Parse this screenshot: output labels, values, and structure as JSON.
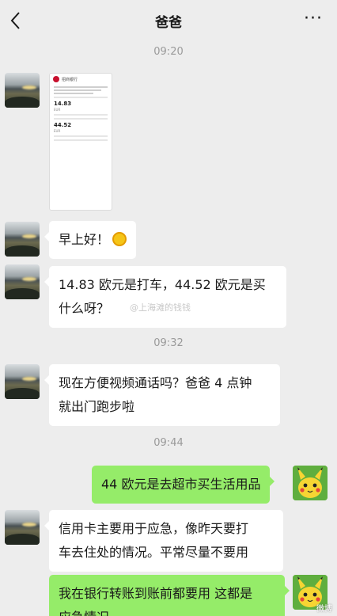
{
  "header": {
    "title": "爸爸",
    "more": "···"
  },
  "times": [
    "09:20",
    "09:32",
    "09:44"
  ],
  "messages": {
    "image_amount_1": "14.83",
    "image_amount_2": "44.52",
    "greeting": "早上好！",
    "question_1": "14.83 欧元是打车，44.52 欧元是买",
    "question_2": "什么呀？",
    "video_1": "现在方便视频通话吗？爸爸 4 点钟",
    "video_2": "就出门跑步啦",
    "me_1": "44 欧元是去超市买生活用品",
    "advice_1": "信用卡主要用于应急，像昨天要打",
    "advice_2": "车去住处的情况。平常尽量不要用",
    "me_2_1": "我在银行转账到账前都要用 这都是",
    "me_2_2": "应急情况"
  },
  "watermark": "@上海滩的钱钱",
  "watermark_corner": "微博"
}
